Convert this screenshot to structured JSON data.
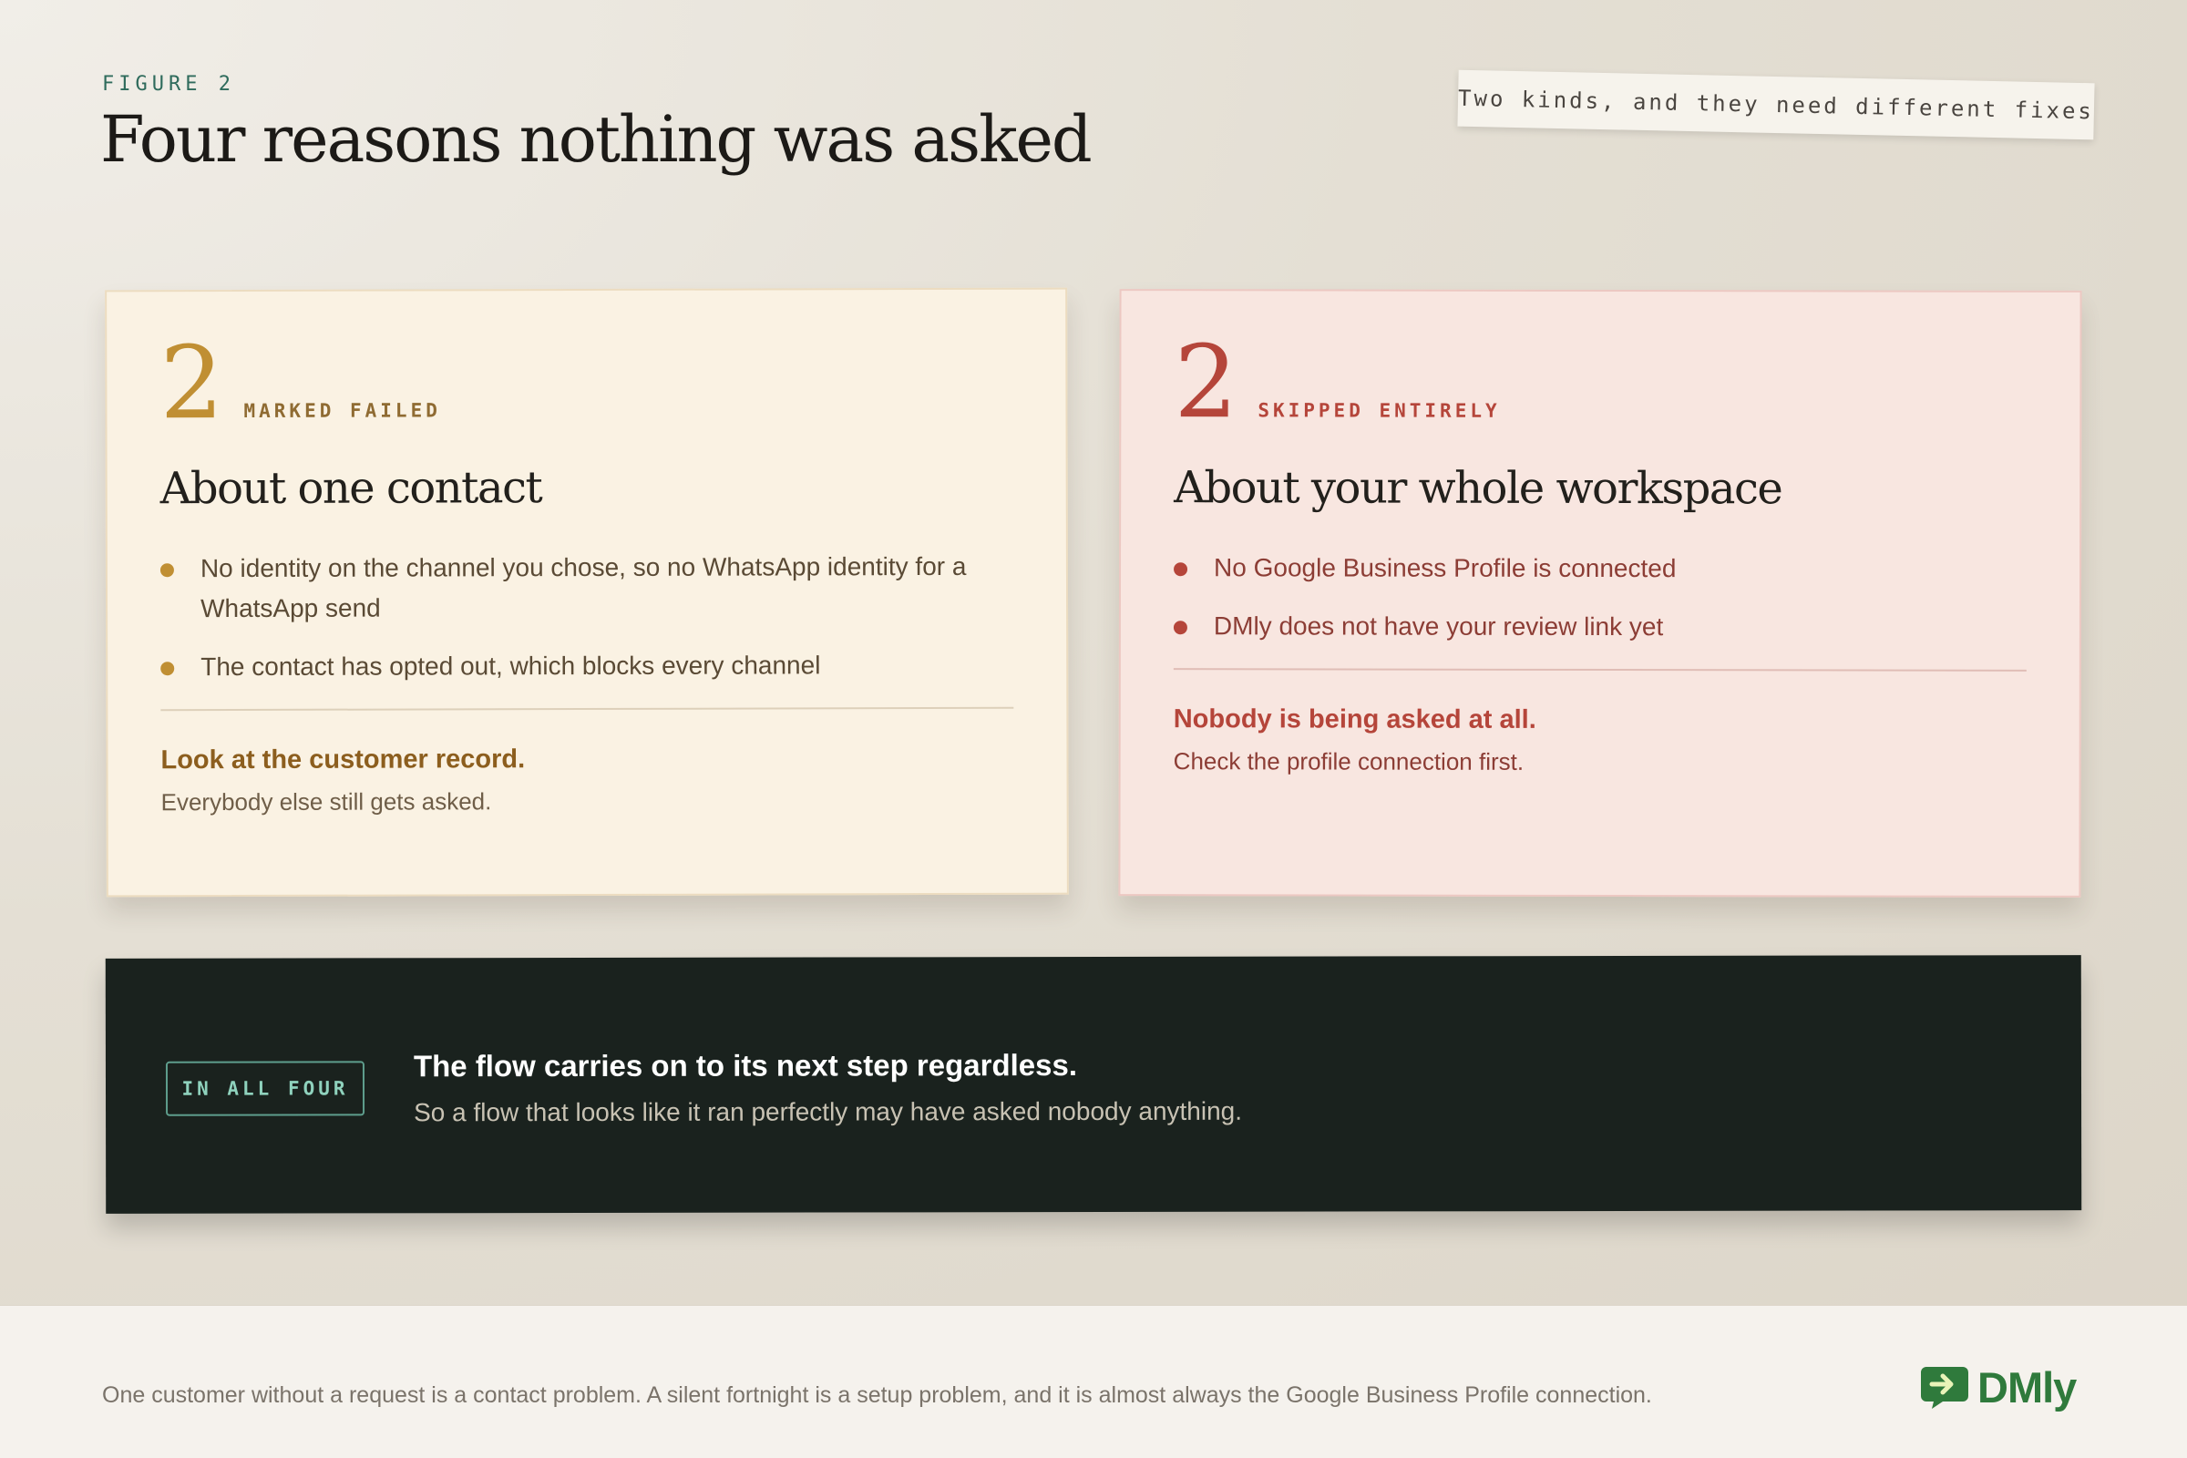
{
  "header": {
    "eyebrow": "FIGURE 2",
    "title": "Four reasons nothing was asked",
    "note": "Two kinds, and they need different fixes"
  },
  "cards": [
    {
      "count": "2",
      "kicker": "MARKED FAILED",
      "title": "About one contact",
      "bullets": [
        "No identity on the channel you chose, so no WhatsApp identity for a WhatsApp send",
        "The contact has opted out, which blocks every channel"
      ],
      "action": "Look at the customer record.",
      "note": "Everybody else still gets asked.",
      "accent": "#c08f33"
    },
    {
      "count": "2",
      "kicker": "SKIPPED ENTIRELY",
      "title": "About your whole workspace",
      "bullets": [
        "No Google Business Profile is connected",
        "DMly does not have your review link yet"
      ],
      "action": "Nobody is being asked at all.",
      "note": "Check the profile connection first.",
      "accent": "#b5453a"
    }
  ],
  "banner": {
    "tag": "IN ALL FOUR",
    "strong": "The flow carries on to its next step regardless.",
    "sub": "So a flow that looks like it ran perfectly may have asked nobody anything."
  },
  "footer": {
    "text": "One customer without a request is a contact problem. A silent fortnight is a setup problem, and it is almost always the Google Business Profile connection.",
    "logo": "DMly",
    "logo_icon": "chat-arrow-icon",
    "brand_color": "#2f7a3c"
  }
}
